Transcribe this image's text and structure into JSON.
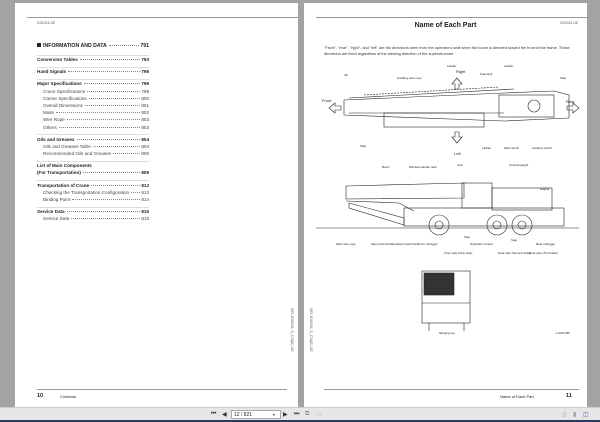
{
  "left_page": {
    "doc_code": "G02014-0E",
    "toc_title": "INFORMATION AND DATA",
    "toc_title_page": "791",
    "sections": [
      {
        "title": "Conversion Tables",
        "page": "793",
        "items": []
      },
      {
        "title": "Hand Signals",
        "page": "796",
        "items": []
      },
      {
        "title": "Major Specifications",
        "page": "799",
        "items": [
          {
            "title": "Crane Specifications",
            "page": "799"
          },
          {
            "title": "Carrier Specifications",
            "page": "800"
          },
          {
            "title": "Overall Dimensions",
            "page": "801"
          },
          {
            "title": "Mass",
            "page": "802"
          },
          {
            "title": "Wire Rope",
            "page": "803"
          },
          {
            "title": "Others",
            "page": "803"
          }
        ]
      },
      {
        "title": "Oils and Greases",
        "page": "804",
        "items": [
          {
            "title": "Oils and Greases Table",
            "page": "804"
          },
          {
            "title": "Recommended Oils and Greases",
            "page": "806"
          }
        ]
      },
      {
        "title": "List of Main Components",
        "title2": "(For Transportation)",
        "page": "809",
        "items": []
      },
      {
        "title": "Transportation of Crane",
        "page": "812",
        "items": [
          {
            "title": "Checking the Transportation Configuration",
            "page": "813"
          },
          {
            "title": "Binding Point",
            "page": "814"
          }
        ]
      },
      {
        "title": "Service Data",
        "page": "815",
        "items": [
          {
            "title": "Service Data",
            "page": "815"
          }
        ]
      }
    ],
    "side_code": "GR-1000XL-3_CN(0)-1E",
    "page_number": "10",
    "footer_label": "Contents"
  },
  "right_page": {
    "doc_code": "G02014-0E",
    "title": "Name of Each Part",
    "paragraph": "\"Front\", \"rear\", \"right\", and \"left\" are the directions seen from the operator's seat when the boom is directed toward the front of the frame. These directions are fixed regardless of the slewing direction of the superstructure.",
    "top_labels": {
      "jib": "Jib",
      "aux_rope": "Auxiliary wire rope",
      "ladder1": "Ladder",
      "right": "Right",
      "fuel": "Fuel tank",
      "ladder2": "Ladder",
      "step1": "Step",
      "front": "Front",
      "rear": "Rear",
      "step2": "Step",
      "left": "Left",
      "ladder3": "Ladder",
      "main_winch": "Main winch",
      "aux_winch": "Auxiliary winch"
    },
    "side_labels": {
      "boom": "Boom",
      "washer": "Window washer tank",
      "cab": "Cab",
      "counterweight": "Counterweight",
      "engine": "Engine",
      "main_rope": "Main wire rope",
      "main_hook": "Main hook block",
      "aux_hook": "Auxiliary hook block",
      "front_out": "Front outrigger",
      "front_axle": "Front axle (First axle)",
      "step": "Step",
      "hyd_tank": "Hydraulic oil tank",
      "rear_axle2": "Rear axle (Second axle)",
      "step2": "Step",
      "rear_axle3": "Rear axle (Third axle)",
      "rear_out": "Rear outrigger"
    },
    "rear_labels": {
      "slinging": "Slinging top",
      "fig_code": "4-G4P2-888"
    },
    "side_code": "GR-1000XL-3_CN(0)-1E",
    "page_number": "11",
    "footer_label": "Name of Each Part"
  },
  "toolbar": {
    "page_field": "12 / 821"
  }
}
